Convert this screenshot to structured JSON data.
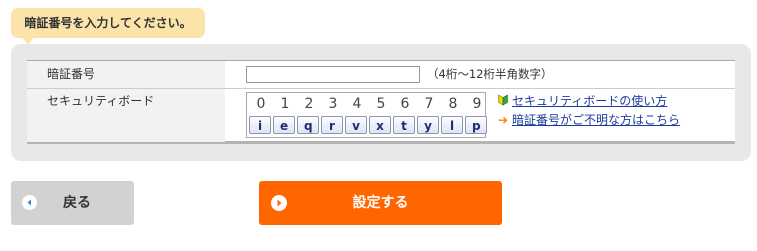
{
  "callout": {
    "text": "暗証番号を入力してください。"
  },
  "form": {
    "pin": {
      "label": "暗証番号",
      "value": "",
      "hint": "（4桁～12桁半角数字）"
    },
    "security_board": {
      "label": "セキュリティボード",
      "digits": [
        "0",
        "1",
        "2",
        "3",
        "4",
        "5",
        "6",
        "7",
        "8",
        "9"
      ],
      "keys": [
        "i",
        "e",
        "q",
        "r",
        "v",
        "x",
        "t",
        "y",
        "l",
        "p"
      ]
    },
    "links": {
      "howto": {
        "text": "セキュリティボードの使い方",
        "icon": "beginner-leaf-icon"
      },
      "forgot": {
        "text": "暗証番号がご不明な方はこちら",
        "icon": "orange-arrow-icon"
      }
    }
  },
  "buttons": {
    "back": {
      "label": "戻る",
      "icon": "left-arrow-circle-icon"
    },
    "submit": {
      "label": "設定する",
      "icon": "right-arrow-circle-icon"
    }
  },
  "colors": {
    "callout_bg": "#fbe3a9",
    "panel_bg": "#e8e8e8",
    "submit_bg": "#ff6600",
    "back_bg": "#d2d2d2",
    "link": "#1a3c9c",
    "key_text": "#1a2f7a"
  }
}
